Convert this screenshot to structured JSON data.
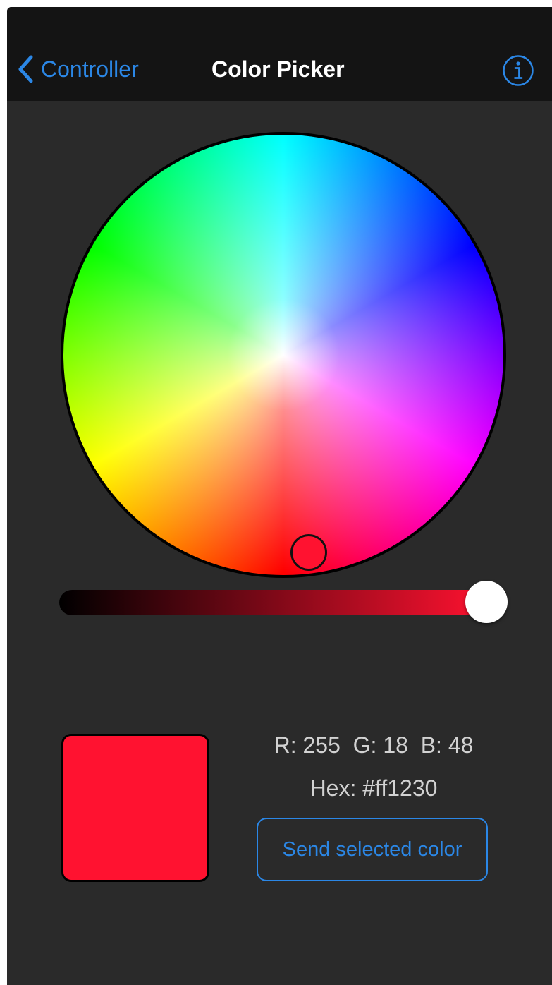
{
  "colors": {
    "accent": "#2b87e6",
    "navbar_bg": "#141414",
    "background": "#2a2a2a",
    "text_secondary": "#d2d2d2"
  },
  "navbar": {
    "back_label": "Controller",
    "back_icon": "chevron-left-icon",
    "title": "Color Picker",
    "info_icon": "info-icon"
  },
  "picker": {
    "selected_color": "#ff1230",
    "brightness_fraction": 1.0
  },
  "readout": {
    "rgb_text": "R: 255  G: 18  B: 48",
    "hex_text": "Hex: #ff1230"
  },
  "actions": {
    "send_label": "Send selected color"
  }
}
